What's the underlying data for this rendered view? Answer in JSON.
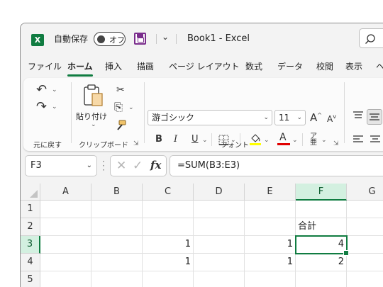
{
  "app": {
    "autosave_label": "自動保存",
    "autosave_state": "オフ",
    "document_title": "Book1  -  Excel",
    "logo_letter": "X"
  },
  "tabs": [
    "ファイル",
    "ホーム",
    "挿入",
    "描画",
    "ページ レイアウト",
    "数式",
    "データ",
    "校閲",
    "表示",
    "ヘ"
  ],
  "active_tab": "ホーム",
  "ribbon": {
    "undo_group_label": "元に戻す",
    "clipboard": {
      "paste_label": "貼り付け",
      "group_label": "クリップボード"
    },
    "font": {
      "font_name": "游ゴシック",
      "font_size": "11",
      "bold": "B",
      "italic": "I",
      "underline": "U",
      "font_color_glyph": "A",
      "grow_glyph": "A",
      "shrink_glyph": "A",
      "group_label": "フォント",
      "highlight_color": "#ffff00",
      "font_color": "#e00000"
    }
  },
  "formula_bar": {
    "name_box": "F3",
    "formula": "=SUM(B3:E3)",
    "fx_label": "fx"
  },
  "sheet": {
    "columns": [
      "A",
      "B",
      "C",
      "D",
      "E",
      "F",
      "G"
    ],
    "rows": [
      "1",
      "2",
      "3",
      "4",
      "5"
    ],
    "selected_column": "F",
    "selected_row": "3",
    "selected_cell": "F3",
    "cells": {
      "F2": "合計",
      "C3": "1",
      "E3": "1",
      "F3": "4",
      "C4": "1",
      "E4": "1",
      "F4": "2"
    }
  },
  "colors": {
    "accent": "#107c41",
    "selection_header": "#d3f0e0"
  }
}
